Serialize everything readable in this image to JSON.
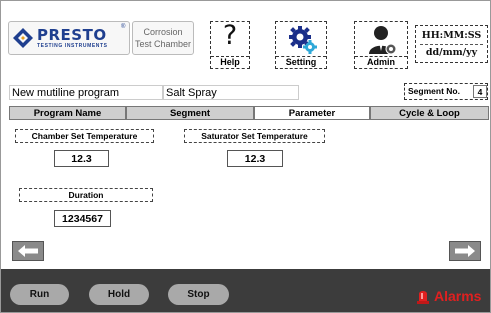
{
  "header": {
    "logo_text": "PRESTO",
    "logo_subtext": "TESTING INSTRUMENTS",
    "logo_reg": "®",
    "chamber_title_line1": "Corrosion",
    "chamber_title_line2": "Test Chamber",
    "help_symbol": "?",
    "help_label": "Help",
    "setting_label": "Setting",
    "admin_label": "Admin",
    "time": "HH:MM:SS",
    "date": "dd/mm/yy"
  },
  "program": {
    "name": "New mutiline program",
    "type": "Salt Spray",
    "segment_label": "Segment No.",
    "segment_value": "4"
  },
  "tabs": [
    {
      "label": "Program Name",
      "active": false
    },
    {
      "label": "Segment",
      "active": false
    },
    {
      "label": "Parameter",
      "active": true
    },
    {
      "label": "Cycle & Loop",
      "active": false
    }
  ],
  "parameters": {
    "chamber_temp_label": "Chamber Set Temperature",
    "chamber_temp_value": "12.3",
    "saturator_temp_label": "Saturator Set Temperature",
    "saturator_temp_value": "12.3",
    "duration_label": "Duration",
    "duration_value": "1234567"
  },
  "controls": {
    "run_label": "Run",
    "hold_label": "Hold",
    "stop_label": "Stop",
    "alarms_label": "Alarms"
  },
  "colors": {
    "brand_blue": "#1f3f8f",
    "alarm_red": "#e02020",
    "bottom_bar": "#3c3c3c",
    "tab_inactive": "#cfcfcf"
  }
}
